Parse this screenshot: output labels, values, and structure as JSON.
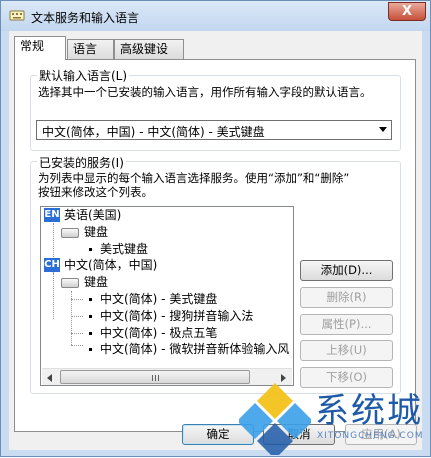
{
  "window": {
    "title": "文本服务和输入语言",
    "close_glyph": "X"
  },
  "tabs": [
    "常规",
    "语言栏",
    "高级键设置"
  ],
  "default_language": {
    "label": "默认输入语言(L)",
    "description": "选择其中一个已安装的输入语言，用作所有输入字段的默认语言。",
    "selected": "中文(简体，中国) - 中文(简体) - 美式键盘"
  },
  "installed_services": {
    "label": "已安装的服务(I)",
    "description_line1": "为列表中显示的每个输入语言选择服务。使用“添加”和“删除”",
    "description_line2": "按钮来修改这个列表。",
    "tree": {
      "lang1": {
        "badge": "EN",
        "name": "英语(美国)",
        "category": "键盘",
        "items": [
          "美式键盘"
        ]
      },
      "lang2": {
        "badge": "CH",
        "name": "中文(简体，中国)",
        "category": "键盘",
        "items": [
          "中文(简体) - 美式键盘",
          "中文(简体) - 搜狗拼音输入法",
          "中文(简体) - 极点五笔",
          "中文(简体) - 微软拼音新体验输入风"
        ]
      }
    },
    "buttons": {
      "add": "添加(D)...",
      "remove": "删除(R)",
      "properties": "属性(P)...",
      "move_up": "上移(U)",
      "move_down": "下移(O)"
    }
  },
  "footer": {
    "ok": "确定",
    "cancel": "取消",
    "apply": "应用(A)"
  },
  "watermark": {
    "text": "系统城",
    "url": "XITONGCHENG.COM"
  },
  "colors": {
    "en_badge": "#2b6fd6",
    "ch_badge": "#2b6fd6",
    "close": "#c74f3a",
    "watermark": "#1e5aa8"
  }
}
